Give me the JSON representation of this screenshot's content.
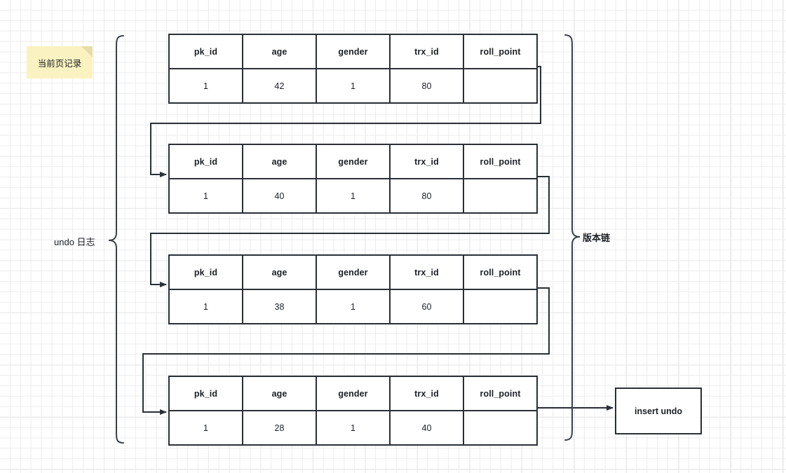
{
  "diagram": {
    "title_note": "当前页记录",
    "left_brace_label": "undo 日志",
    "right_brace_label": "版本链",
    "insert_undo_label": "insert undo",
    "columns": [
      "pk_id",
      "age",
      "gender",
      "trx_id",
      "roll_point"
    ],
    "colors": {
      "stroke": "#2b2f36",
      "note_fill": "#faf2c0",
      "note_fold": "#e6dda8",
      "grid_minor": "#ededed",
      "grid_major": "#e0e0e0",
      "box_fill": "#ffffff",
      "text": "#1c1f24"
    },
    "records": [
      {
        "name": "current-page-record",
        "cells": {
          "pk_id": "1",
          "age": "42",
          "gender": "1",
          "trx_id": "80",
          "roll_point": ""
        }
      },
      {
        "name": "undo-record-1",
        "cells": {
          "pk_id": "1",
          "age": "40",
          "gender": "1",
          "trx_id": "80",
          "roll_point": ""
        }
      },
      {
        "name": "undo-record-2",
        "cells": {
          "pk_id": "1",
          "age": "38",
          "gender": "1",
          "trx_id": "60",
          "roll_point": ""
        }
      },
      {
        "name": "undo-record-3",
        "cells": {
          "pk_id": "1",
          "age": "28",
          "gender": "1",
          "trx_id": "40",
          "roll_point": ""
        }
      }
    ]
  }
}
